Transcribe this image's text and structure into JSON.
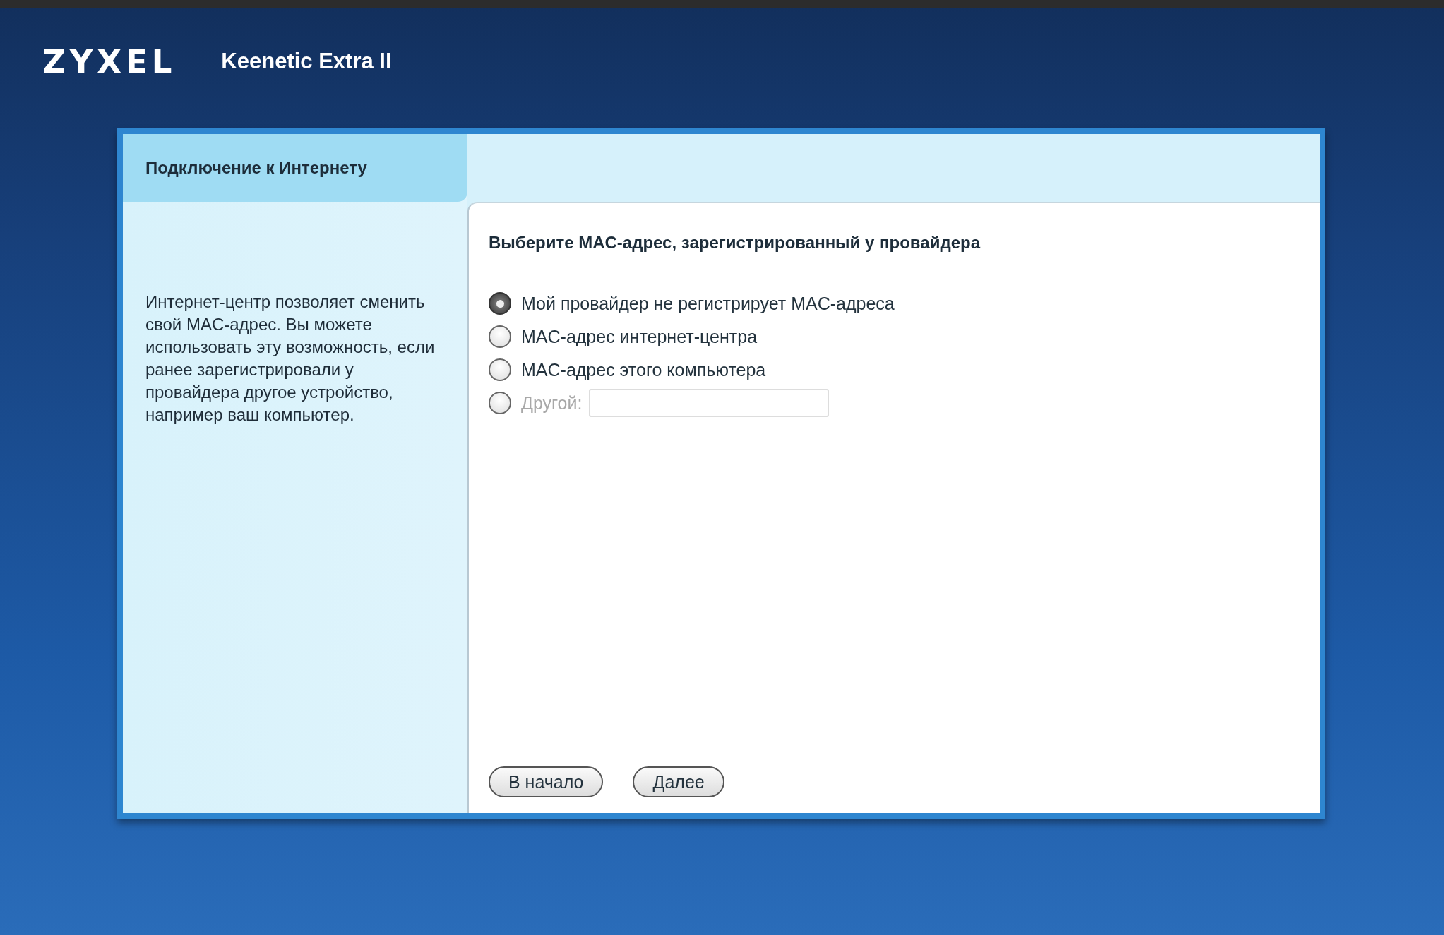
{
  "header": {
    "logo": "ZYXEL",
    "model": "Keenetic Extra II"
  },
  "sidebar": {
    "title": "Подключение к Интернету",
    "description": "Интернет-центр позволяет сменить свой MAC-адрес. Вы можете использовать эту возможность, если ранее зарегистрировали у провайдера другое устройство, например ваш компьютер."
  },
  "content": {
    "heading": "Выберите MAC-адрес, зарегистрированный у провайдера",
    "options": [
      {
        "label": "Мой провайдер не регистрирует MAC-адреса",
        "selected": true,
        "disabled": false,
        "kind": "plain"
      },
      {
        "label": "MAC-адрес интернет-центра",
        "selected": false,
        "disabled": false,
        "kind": "plain"
      },
      {
        "label": "MAC-адрес этого компьютера",
        "selected": false,
        "disabled": false,
        "kind": "plain"
      },
      {
        "label": "Другой:",
        "selected": false,
        "disabled": true,
        "kind": "field"
      }
    ],
    "buttons": [
      "В начало",
      "Далее"
    ]
  }
}
